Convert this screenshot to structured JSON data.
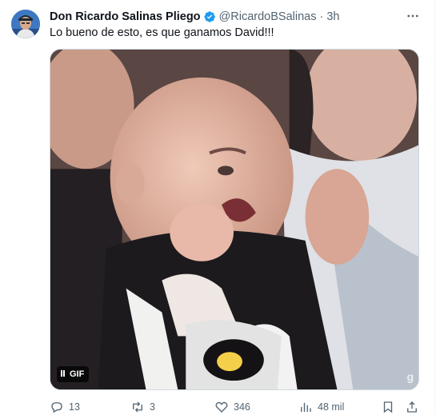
{
  "author": {
    "display_name": "Don Ricardo Salinas Pliego",
    "handle": "@RicardoBSalinas",
    "separator": "·",
    "time": "3h",
    "verified": true,
    "verified_color": "#1d9bf0"
  },
  "tweet": {
    "text": "Lo bueno de esto, es que ganamos David!!!"
  },
  "media": {
    "badge_label": "GIF",
    "watermark": "g"
  },
  "actions": {
    "replies": "13",
    "reposts": "3",
    "likes": "346",
    "views": "48 mil"
  },
  "icons": {
    "more": "more-horizontal-icon",
    "reply": "reply-icon",
    "repost": "repost-icon",
    "like": "heart-icon",
    "views": "views-bar-chart-icon",
    "bookmark": "bookmark-icon",
    "share": "share-icon"
  },
  "colors": {
    "text_primary": "#0f1419",
    "text_secondary": "#536471",
    "border": "#cfd9de"
  }
}
